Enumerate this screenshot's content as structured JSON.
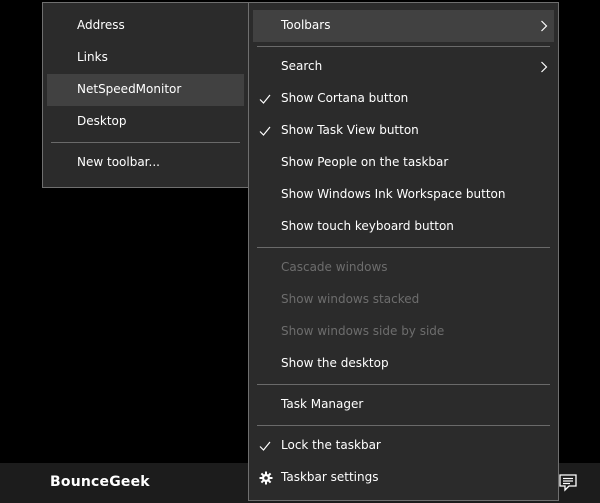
{
  "taskbar": {
    "label": "BounceGeek",
    "tray_icon": "action-center-icon"
  },
  "main_menu": {
    "toolbars": "Toolbars",
    "search": "Search",
    "show_cortana": "Show Cortana button",
    "show_task_view": "Show Task View button",
    "show_people": "Show People on the taskbar",
    "show_ink": "Show Windows Ink Workspace button",
    "show_touch_keyboard": "Show touch keyboard button",
    "cascade": "Cascade windows",
    "stacked": "Show windows stacked",
    "side_by_side": "Show windows side by side",
    "show_desktop": "Show the desktop",
    "task_manager": "Task Manager",
    "lock_taskbar": "Lock the taskbar",
    "taskbar_settings": "Taskbar settings"
  },
  "toolbars_submenu": {
    "address": "Address",
    "links": "Links",
    "netspeed": "NetSpeedMonitor",
    "desktop": "Desktop",
    "new_toolbar": "New toolbar..."
  },
  "colors": {
    "menu_bg": "#2b2b2b",
    "menu_border": "#6f6f6f",
    "hover": "#414141",
    "text": "#ffffff",
    "disabled_text": "#6d6d6d",
    "taskbar_bg": "#1c1c1c",
    "desktop_bg": "#000000"
  }
}
